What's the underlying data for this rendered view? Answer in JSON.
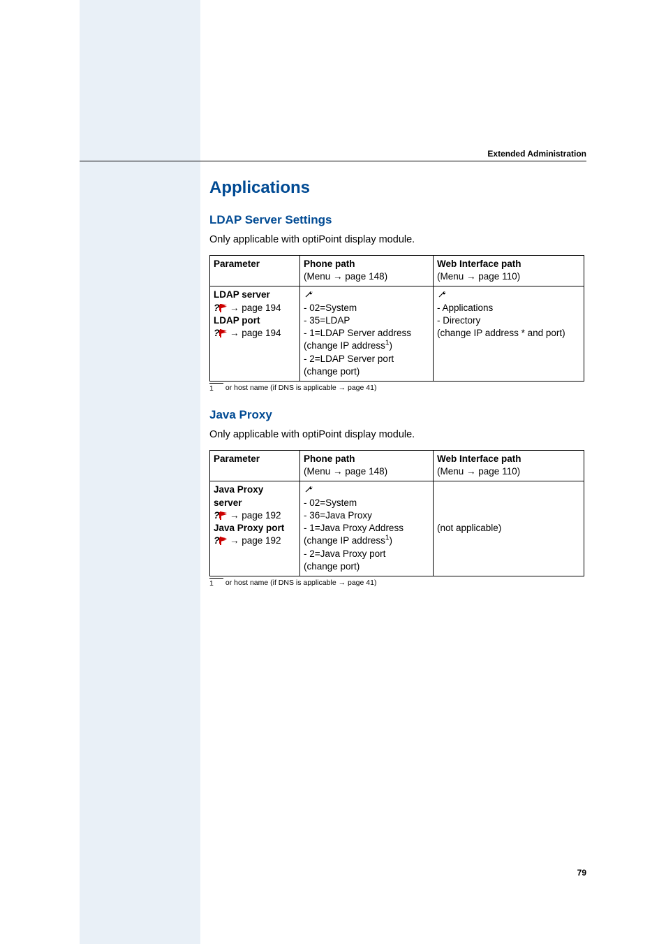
{
  "header": {
    "section": "Extended Administration"
  },
  "page_number": "79",
  "applications": {
    "title": "Applications",
    "ldap": {
      "title": "LDAP Server Settings",
      "intro": "Only applicable with optiPoint display module.",
      "table": {
        "head": {
          "param": "Parameter",
          "phone": "Phone path",
          "phone_menu_prefix": "(Menu ",
          "phone_menu_link": " page 148)",
          "web": "Web Interface path",
          "web_menu_prefix": "(Menu ",
          "web_menu_link": " page 110)"
        },
        "row": {
          "param_server": "LDAP server",
          "param_server_link": " page 194",
          "param_port": "LDAP port",
          "param_port_link": " page 194",
          "phone_l1": "- 02=System",
          "phone_l2": "- 35=LDAP",
          "phone_l3": "- 1=LDAP Server address",
          "phone_l4_pre": "(change IP address",
          "phone_l4_post": ")",
          "phone_l5": "- 2=LDAP Server port",
          "phone_l6": "(change port)",
          "web_l1": "- Applications",
          "web_l2": "- Directory",
          "web_l3": "(change IP address * and port)"
        }
      },
      "footnote_num": "1",
      "footnote_text_pre": "or host name (if DNS is applicable ",
      "footnote_text_link": " page 41)"
    },
    "java": {
      "title": "Java Proxy",
      "intro": "Only applicable with optiPoint display module.",
      "table": {
        "head": {
          "param": "Parameter",
          "phone": "Phone path",
          "phone_menu_prefix": "(Menu ",
          "phone_menu_link": " page 148)",
          "web": "Web Interface path",
          "web_menu_prefix": "(Menu ",
          "web_menu_link": " page 110)"
        },
        "row": {
          "param_server_l1": "Java Proxy",
          "param_server_l2": "server",
          "param_server_link": " page 192",
          "param_port": "Java Proxy port",
          "param_port_link": " page 192",
          "phone_l1": "- 02=System",
          "phone_l2": "- 36=Java Proxy",
          "phone_l3": "- 1=Java Proxy Address",
          "phone_l4_pre": "(change IP address",
          "phone_l4_post": ")",
          "phone_l5": "- 2=Java Proxy port",
          "phone_l6": "(change port)",
          "web": "(not applicable)"
        }
      },
      "footnote_num": "1",
      "footnote_text_pre": "or host name (if DNS is applicable ",
      "footnote_text_link": " page 41)"
    }
  }
}
